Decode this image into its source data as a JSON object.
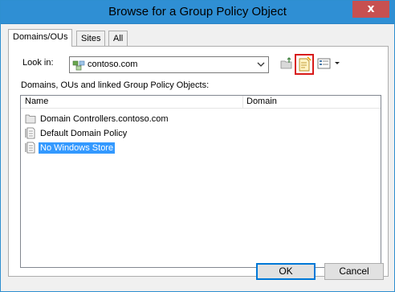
{
  "window": {
    "title": "Browse for a Group Policy Object",
    "close_glyph": "x"
  },
  "tabs": [
    {
      "label": "Domains/OUs",
      "active": true
    },
    {
      "label": "Sites",
      "active": false
    },
    {
      "label": "All",
      "active": false
    }
  ],
  "look_in": {
    "label": "Look in:",
    "value": "contoso.com",
    "icon": "domain-icon"
  },
  "toolbar": {
    "up_icon": "up-one-level-icon",
    "new_gpo_icon": "new-gpo-icon",
    "view_icon": "view-menu-icon",
    "highlight_color": "#d81a1a"
  },
  "list": {
    "caption": "Domains, OUs and linked Group Policy Objects:",
    "columns": [
      "Name",
      "Domain"
    ],
    "rows": [
      {
        "name": "Domain Controllers.contoso.com",
        "domain": "",
        "icon": "folder-icon",
        "selected": false
      },
      {
        "name": "Default Domain Policy",
        "domain": "",
        "icon": "gpo-icon",
        "selected": false
      },
      {
        "name": "No Windows Store",
        "domain": "",
        "icon": "gpo-icon",
        "selected": true
      }
    ]
  },
  "buttons": {
    "ok": "OK",
    "cancel": "Cancel"
  },
  "colors": {
    "titlebar": "#2f8fd4",
    "close_button": "#c75050",
    "selection": "#3399ff"
  }
}
